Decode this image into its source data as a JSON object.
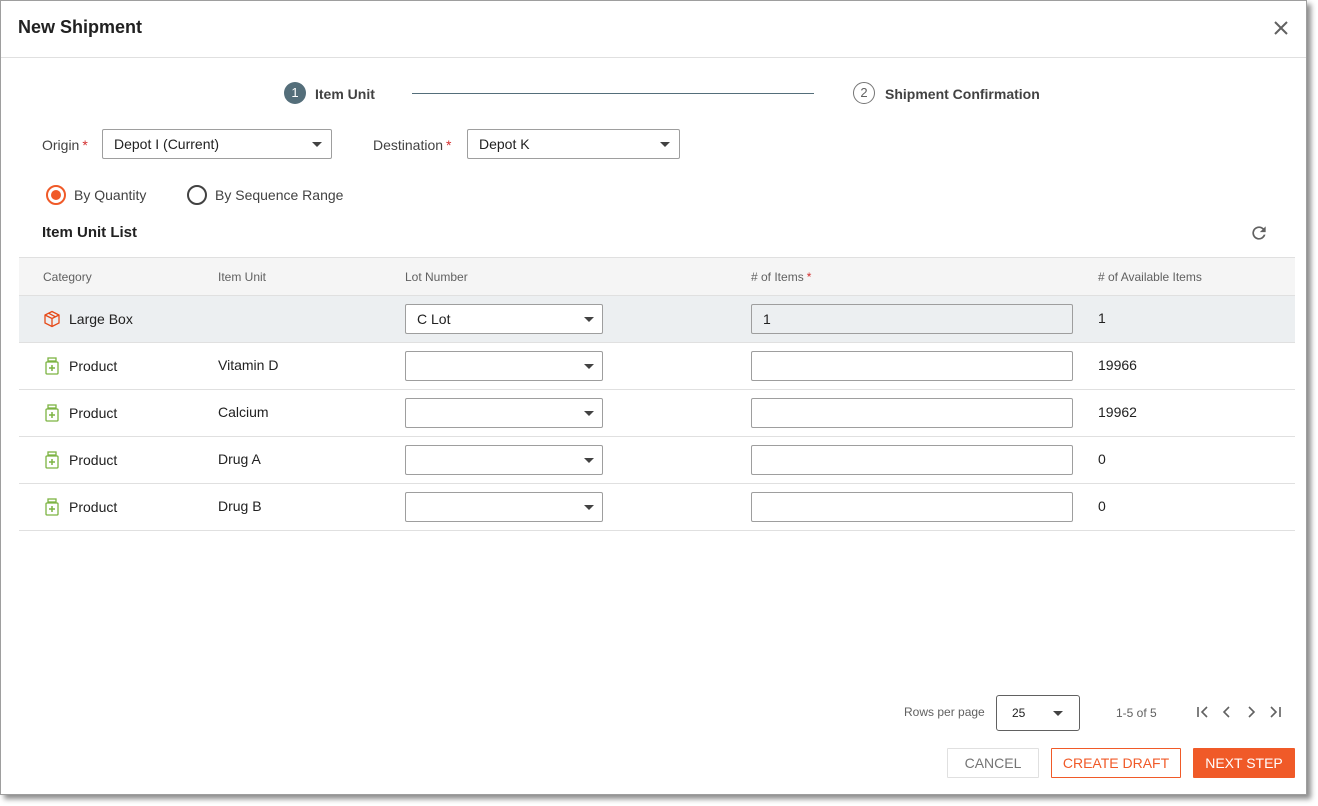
{
  "dialog": {
    "title": "New Shipment"
  },
  "stepper": {
    "steps": [
      {
        "number": "1",
        "label": "Item Unit",
        "active": true
      },
      {
        "number": "2",
        "label": "Shipment Confirmation",
        "active": false
      }
    ]
  },
  "origin": {
    "label": "Origin",
    "required": "*",
    "value": "Depot I (Current)"
  },
  "destination": {
    "label": "Destination",
    "required": "*",
    "value": "Depot K"
  },
  "mode": {
    "options": [
      {
        "label": "By Quantity",
        "selected": true
      },
      {
        "label": "By Sequence Range",
        "selected": false
      }
    ]
  },
  "item_list": {
    "title": "Item Unit List",
    "columns": {
      "category": "Category",
      "item_unit": "Item Unit",
      "lot_number": "Lot Number",
      "num_items": "# of Items",
      "num_items_required": "*",
      "available": "# of Available Items"
    },
    "rows": [
      {
        "category": "Large Box",
        "icon": "box-icon",
        "item_unit": "",
        "lot": "C Lot",
        "num_items": "1",
        "available": "1",
        "selected": true
      },
      {
        "category": "Product",
        "icon": "medicine-bottle-icon",
        "item_unit": "Vitamin D",
        "lot": "",
        "num_items": "",
        "available": "19966",
        "selected": false
      },
      {
        "category": "Product",
        "icon": "medicine-bottle-icon",
        "item_unit": "Calcium",
        "lot": "",
        "num_items": "",
        "available": "19962",
        "selected": false
      },
      {
        "category": "Product",
        "icon": "medicine-bottle-icon",
        "item_unit": "Drug A",
        "lot": "",
        "num_items": "",
        "available": "0",
        "selected": false
      },
      {
        "category": "Product",
        "icon": "medicine-bottle-icon",
        "item_unit": "Drug B",
        "lot": "",
        "num_items": "",
        "available": "0",
        "selected": false
      }
    ]
  },
  "pagination": {
    "rows_per_page_label": "Rows per page",
    "rows_per_page": "25",
    "range": "1-5 of 5"
  },
  "actions": {
    "cancel": "CANCEL",
    "create_draft": "CREATE DRAFT",
    "next_step": "NEXT STEP"
  },
  "colors": {
    "accent": "#f05a28",
    "step_active": "#546e7a",
    "box_icon": "#e64a19",
    "product_icon": "#7cb342",
    "selected_row": "#eceff1"
  }
}
